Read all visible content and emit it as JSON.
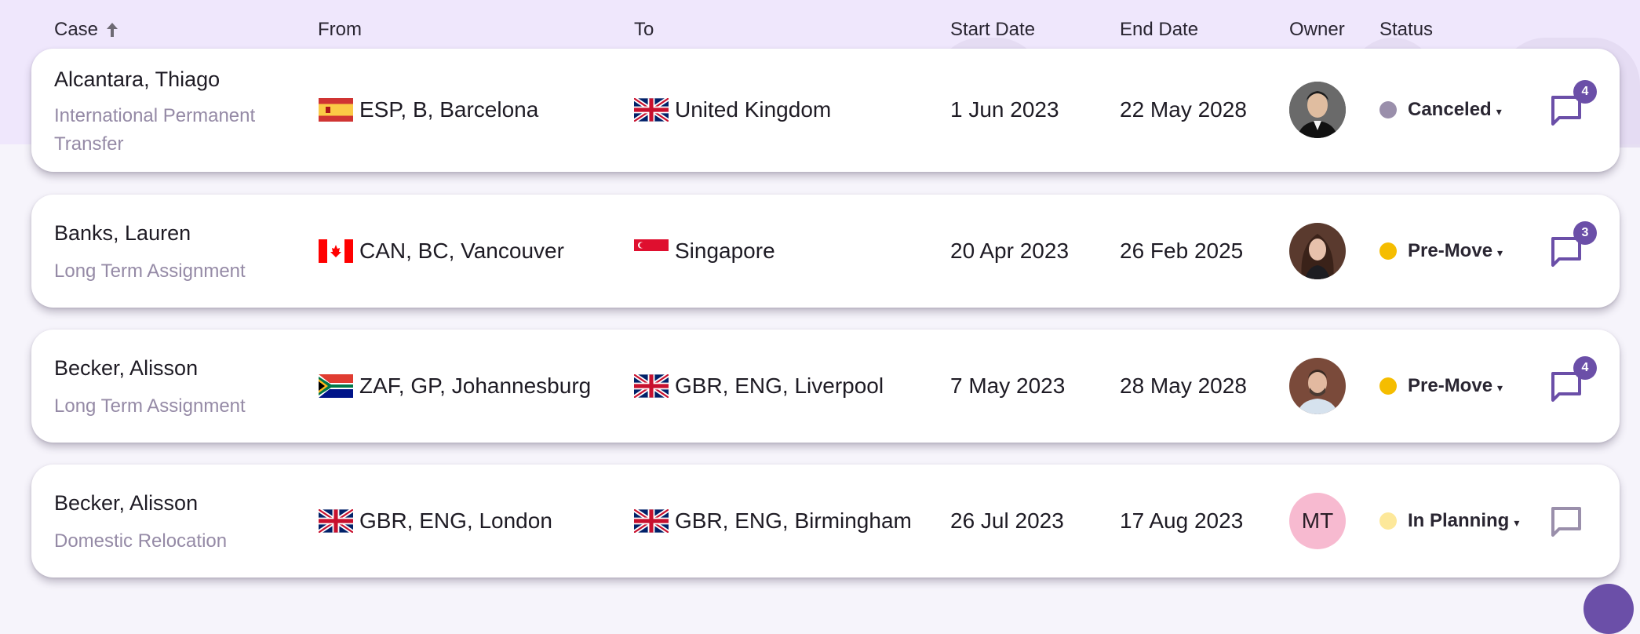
{
  "header": {
    "columns": [
      {
        "key": "case",
        "label": "Case",
        "sort": "ascending"
      },
      {
        "key": "from",
        "label": "From"
      },
      {
        "key": "to",
        "label": "To"
      },
      {
        "key": "start",
        "label": "Start Date"
      },
      {
        "key": "end",
        "label": "End Date"
      },
      {
        "key": "owner",
        "label": "Owner"
      },
      {
        "key": "status",
        "label": "Status"
      }
    ]
  },
  "colors": {
    "accent": "#6b4fa8",
    "status_canceled": "#9a8fab",
    "status_premove": "#f5bd00",
    "status_inplanning": "#fde89a",
    "subtitle_text": "#958aa6",
    "header_band": "#efe7fc"
  },
  "rows": [
    {
      "name": "Alcantara, Thiago",
      "type": "International Permanent Transfer",
      "from": {
        "flag": "ESP",
        "text": "ESP, B, Barcelona"
      },
      "to": {
        "flag": "GBR",
        "text": "United Kingdom"
      },
      "start": "1 Jun 2023",
      "end": "22 May 2028",
      "owner": {
        "kind": "photo",
        "description": "man-dark-hair-suit"
      },
      "status": {
        "label": "Canceled",
        "color": "#9a8fab"
      },
      "comments": "4"
    },
    {
      "name": "Banks, Lauren",
      "type": "Long Term Assignment",
      "from": {
        "flag": "CAN",
        "text": "CAN, BC, Vancouver"
      },
      "to": {
        "flag": "SGP",
        "text": "Singapore"
      },
      "start": "20 Apr 2023",
      "end": "26 Feb 2025",
      "owner": {
        "kind": "photo",
        "description": "woman-long-brown-hair"
      },
      "status": {
        "label": "Pre-Move",
        "color": "#f5bd00"
      },
      "comments": "3"
    },
    {
      "name": "Becker, Alisson",
      "type": "Long Term Assignment",
      "from": {
        "flag": "ZAF",
        "text": "ZAF, GP, Johannesburg"
      },
      "to": {
        "flag": "GBR",
        "text": "GBR, ENG, Liverpool"
      },
      "start": "7 May 2023",
      "end": "28 May 2028",
      "owner": {
        "kind": "photo",
        "description": "man-beard-light-shirt"
      },
      "status": {
        "label": "Pre-Move",
        "color": "#f5bd00"
      },
      "comments": "4"
    },
    {
      "name": "Becker, Alisson",
      "type": "Domestic Relocation",
      "from": {
        "flag": "GBR",
        "text": "GBR, ENG, London"
      },
      "to": {
        "flag": "GBR",
        "text": "GBR, ENG, Birmingham"
      },
      "start": "26 Jul 2023",
      "end": "17 Aug 2023",
      "owner": {
        "kind": "initials",
        "initials": "MT"
      },
      "status": {
        "label": "In Planning",
        "color": "#fde89a"
      },
      "comments": ""
    }
  ],
  "icons": {
    "sort": "arrow-up-icon",
    "caret": "▾",
    "chat": "chat-bubble-icon"
  }
}
